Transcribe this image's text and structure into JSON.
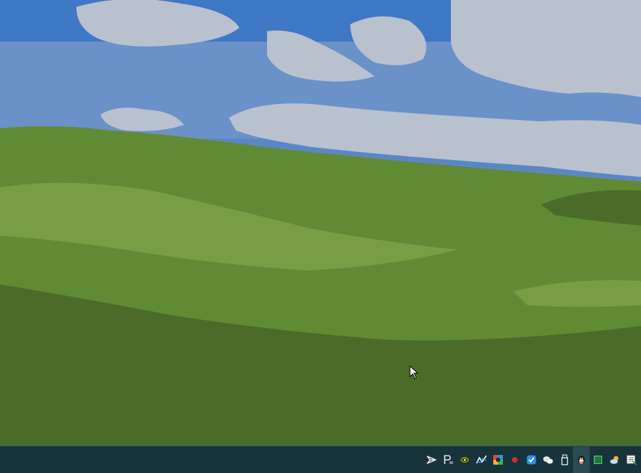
{
  "desktop": {
    "wallpaper": "green-hills-blue-sky",
    "colors": {
      "sky": "#5b86c4",
      "cloud": "#b9c1cf",
      "grass_light": "#779e43",
      "grass_mid": "#608a34",
      "grass_dark": "#4a6c28"
    }
  },
  "taskbar": {
    "background": "#17343d",
    "tray_icons": [
      {
        "name": "visual-studio-icon"
      },
      {
        "name": "p-editor-icon"
      },
      {
        "name": "nvidia-settings-icon"
      },
      {
        "name": "network-monitor-icon"
      },
      {
        "name": "colorful-app-icon"
      },
      {
        "name": "red-dot-icon"
      },
      {
        "name": "blue-check-icon"
      },
      {
        "name": "wechat-icon"
      },
      {
        "name": "usb-drive-icon"
      },
      {
        "name": "qq-penguin-icon"
      },
      {
        "name": "green-square-icon"
      },
      {
        "name": "weather-icon"
      },
      {
        "name": "notifications-icon"
      }
    ]
  }
}
